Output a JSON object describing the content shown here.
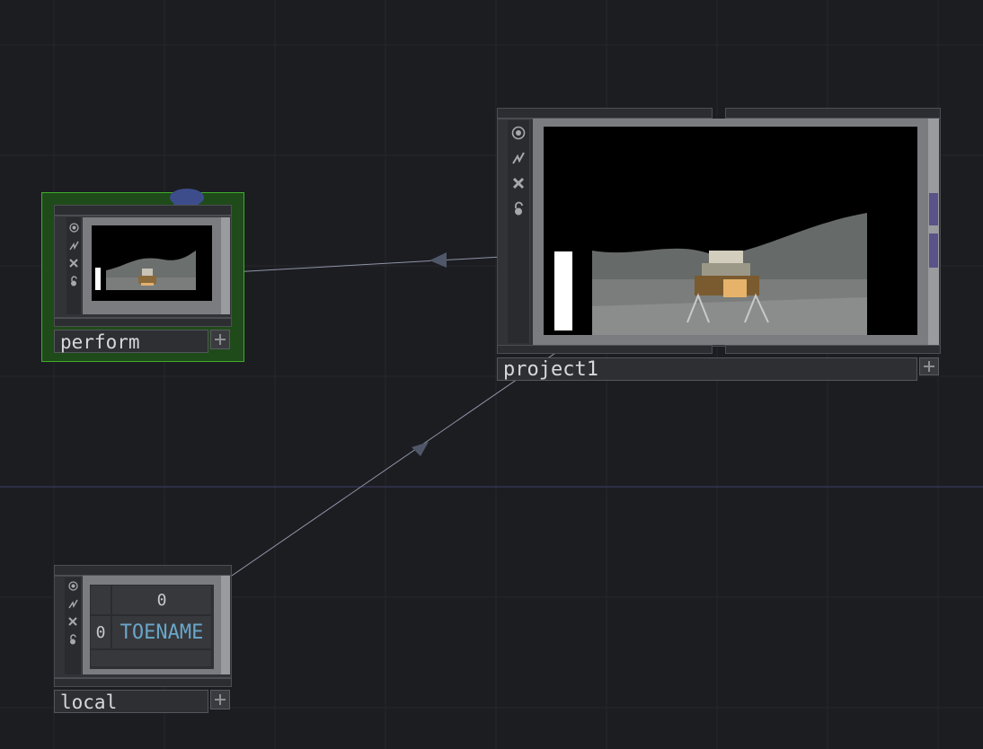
{
  "nodes": {
    "perform": {
      "name": "perform",
      "type": "TOP",
      "selected": true,
      "has_comment": true
    },
    "project1": {
      "name": "project1",
      "type": "TOP"
    },
    "local": {
      "name": "local",
      "type": "DAT",
      "table": {
        "col_header": "0",
        "row_header": "0",
        "cell": "TOENAME"
      }
    }
  },
  "flag_icons": [
    "viewer-icon",
    "bypass-icon",
    "cook-icon",
    "lock-icon"
  ],
  "colors": {
    "background": "#1c1d21",
    "selected_border": "#3fae2b",
    "comment_bubble": "#3d4d8c",
    "table_text_accent": "#6aa6c8",
    "wire": "#9aa0b0"
  }
}
